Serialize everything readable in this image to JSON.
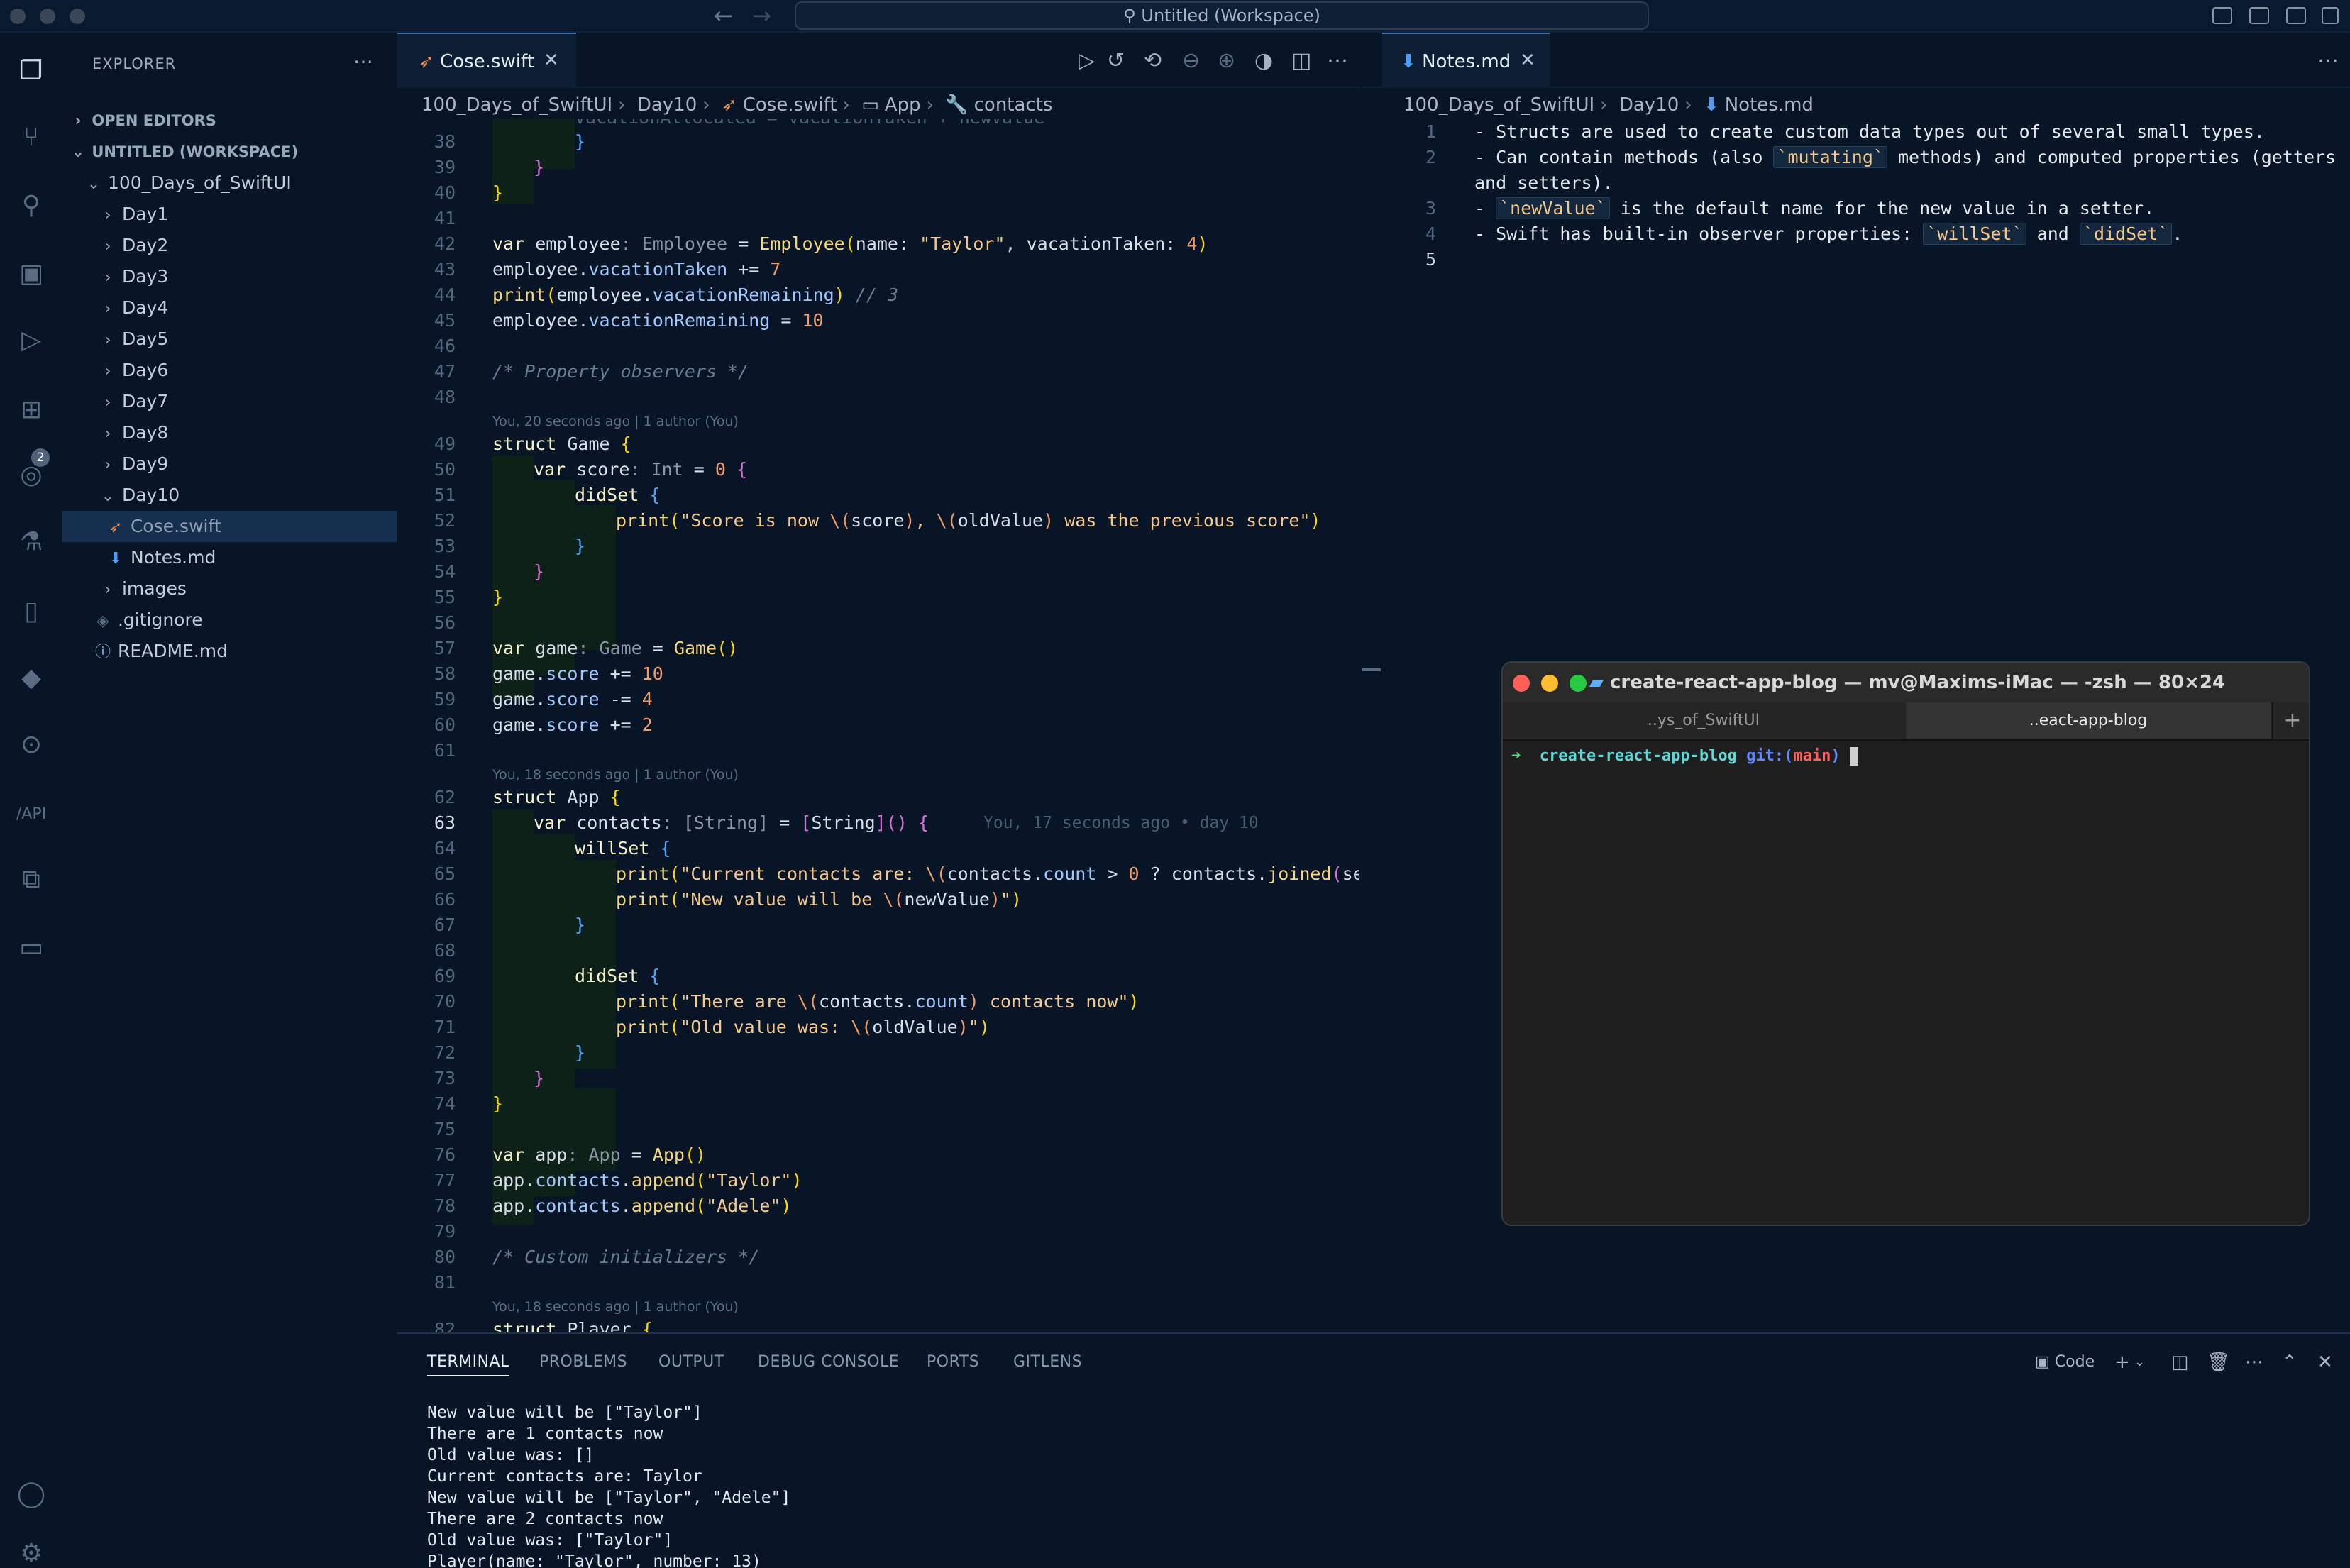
{
  "window": {
    "title": "Untitled (Workspace)"
  },
  "sidebar": {
    "title": "EXPLORER",
    "open_editors": "OPEN EDITORS",
    "workspace": "UNTITLED (WORKSPACE)",
    "root_folder": "100_Days_of_SwiftUI",
    "folders": [
      "Day1",
      "Day2",
      "Day3",
      "Day4",
      "Day5",
      "Day6",
      "Day7",
      "Day8",
      "Day9"
    ],
    "open_folder": "Day10",
    "day10_files": [
      "Cose.swift",
      "Notes.md"
    ],
    "other": [
      "images",
      ".gitignore",
      "README.md"
    ]
  },
  "activity": {
    "extensions_badge": "2"
  },
  "editor1": {
    "tab": "Cose.swift",
    "breadcrumb": [
      "100_Days_of_SwiftUI",
      "Day10",
      "Cose.swift",
      "App",
      "contacts"
    ],
    "lens_1": "You, 20 seconds ago | 1 author (You)",
    "lens_2": "You, 18 seconds ago | 1 author (You)",
    "lens_3": "You, 18 seconds ago | 1 author (You)",
    "blame_63": "You, 17 seconds ago • day 10",
    "top_partial": "vacationAllocated = vacationTaken + newValue"
  },
  "editor2": {
    "tab": "Notes.md",
    "breadcrumb": [
      "100_Days_of_SwiftUI",
      "Day10",
      "Notes.md"
    ],
    "l1": "- Structs are used to create custom data types out of several small types.",
    "l2a": "- Can contain methods (also ",
    "l2code": "`mutating`",
    "l2b": " methods) and computed properties (getters",
    "l2c": "and setters).",
    "l3code": "`newValue`",
    "l3b": " is the default name for the new value in a setter.",
    "l4a": "- Swift has built-in observer properties: ",
    "l4code1": "`willSet`",
    "l4and": " and ",
    "l4code2": "`didSet`",
    "l4end": "."
  },
  "terminal_window": {
    "title": "create-react-app-blog — mv@Maxims-iMac — -zsh — 80×24",
    "tab1": "..ys_of_SwiftUI",
    "tab2": "..eact-app-blog",
    "prompt_arrow": "➜",
    "prompt_dir": "create-react-app-blog",
    "prompt_git": "git:(",
    "prompt_branch": "main",
    "prompt_git_end": ")"
  },
  "panel": {
    "tabs": [
      "TERMINAL",
      "PROBLEMS",
      "OUTPUT",
      "DEBUG CONSOLE",
      "PORTS",
      "GITLENS"
    ],
    "shell_label": "Code",
    "output": [
      "New value will be [\"Taylor\"]",
      "There are 1 contacts now",
      "Old value was: []",
      "Current contacts are: Taylor",
      "New value will be [\"Taylor\", \"Adele\"]",
      "There are 2 contacts now",
      "Old value was: [\"Taylor\"]",
      "Player(name: \"Taylor\", number: 13)"
    ]
  }
}
